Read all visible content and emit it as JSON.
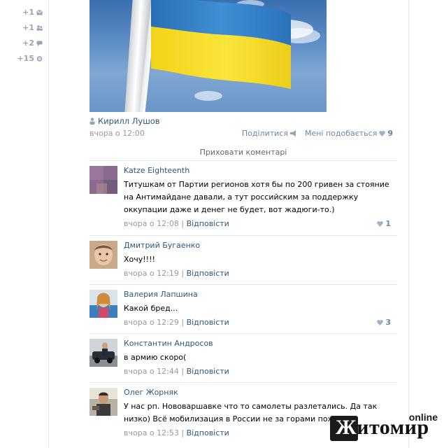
{
  "left_counters": [
    {
      "value": "+1",
      "icon": "envelope-icon"
    },
    {
      "value": "+1",
      "icon": "users-icon"
    },
    {
      "value": "+2",
      "icon": "comment-icon"
    },
    {
      "value": "+15",
      "icon": "gear-icon"
    }
  ],
  "post": {
    "author": "Кирилл Лушов",
    "date": "вчора о 12:00",
    "share_label": "Поділитися",
    "share_count": "",
    "like_label": "Мені подобається",
    "like_count": "9",
    "hide_comments": "Приховати коментарі"
  },
  "comments": [
    {
      "name": "Katze Eighteenth",
      "text": "Титушкам от Партии регионов хотя бы по 200 гривен за стояние на Антимайдане давали, а тут российским за поддержку оккупации даже и денег не будет, вот жадюги-то.)",
      "time": "вчора о 12:08",
      "reply": "Відповісти",
      "likes": "1",
      "sep": " | "
    },
    {
      "name": "Дмитрий Бугаенко",
      "text": "Хочу!!!!",
      "time": "вчора о 12:19",
      "reply": "Відповісти",
      "likes": "",
      "sep": " | "
    },
    {
      "name": "Валерия Лапшина",
      "text": "Какой бред...",
      "time": "вчора о 12:29",
      "reply": "Відповісти",
      "likes": "3",
      "sep": " | "
    },
    {
      "name": "Константин Андросов",
      "text": "в армию скоро(",
      "time": "вчора о 12:44",
      "reply": "Відповісти",
      "likes": "",
      "sep": " | "
    },
    {
      "name": "Олег Жорняк",
      "text": "У нас рп. Нововаршавке что то самолеты разлетались. Да так низко) Всё мобилизация в России не за горами походу)",
      "time": "вчора о 12:53",
      "reply": "Відповісти",
      "likes": "",
      "sep": " | "
    }
  ],
  "watermark": {
    "main_first": "Ж",
    "main_rest": "итомир",
    "online": "online"
  },
  "colors": {
    "link": "#2b587a",
    "muted": "#999999",
    "accent": "#6a88a6",
    "flag_blue": "#2e7cc4",
    "flag_yellow": "#f7e02a"
  }
}
